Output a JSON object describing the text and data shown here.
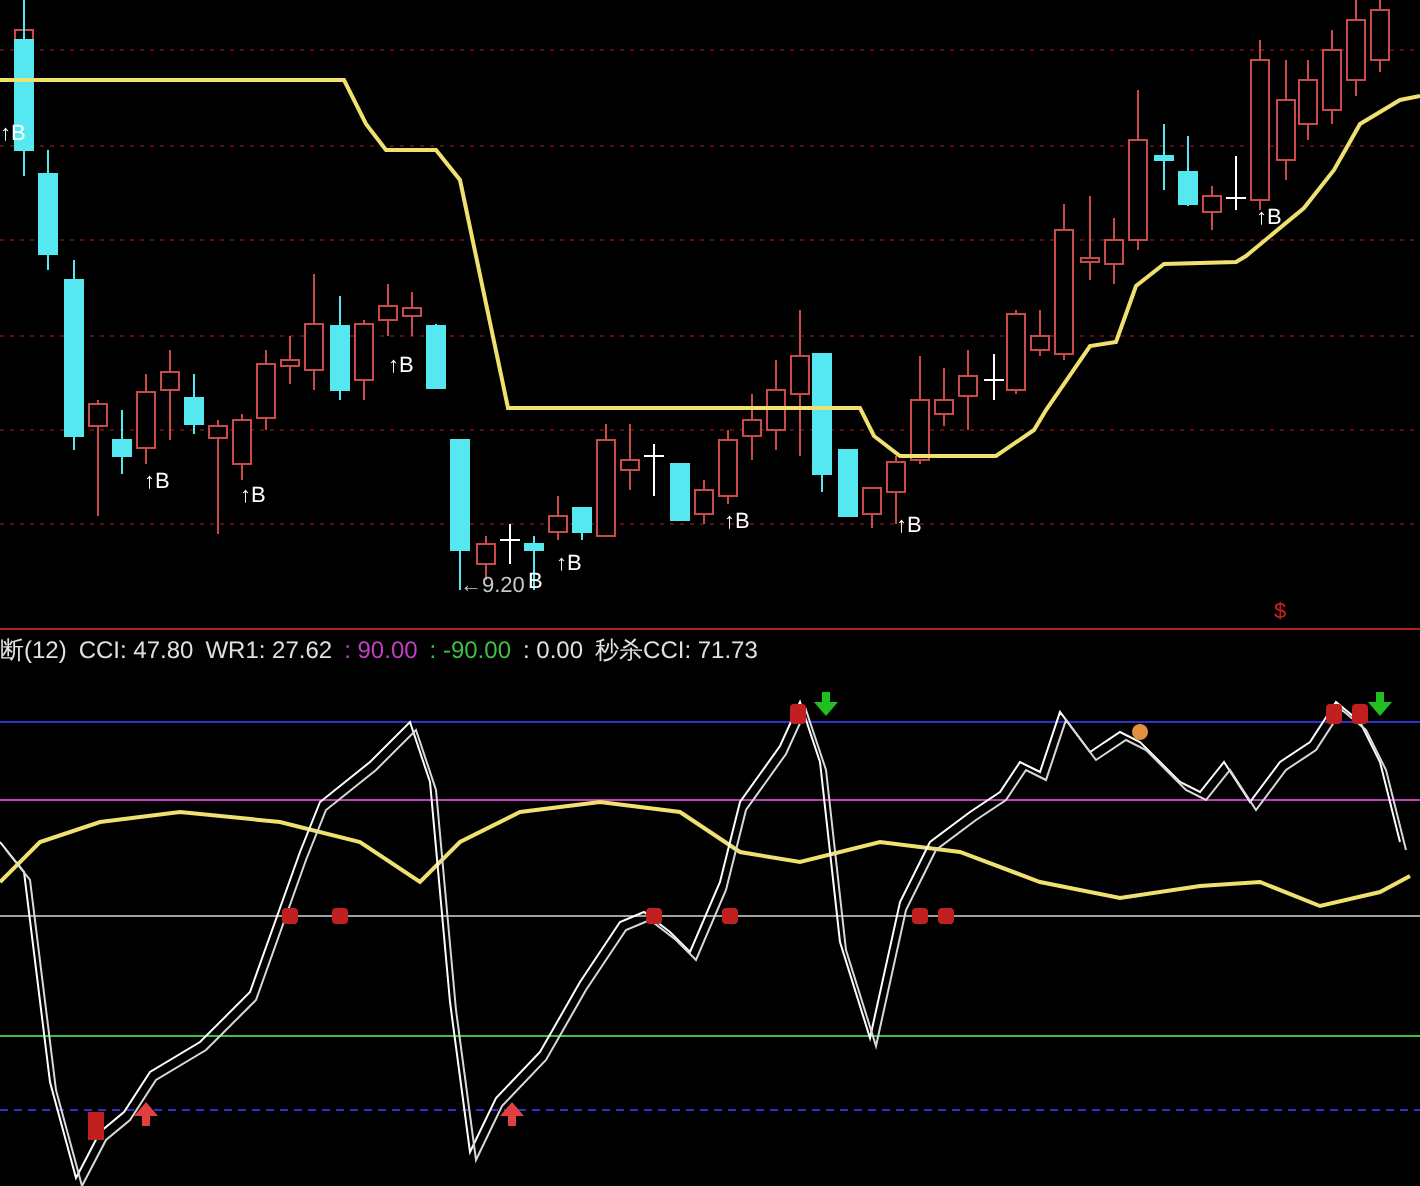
{
  "price_panel": {
    "signal_labels": [
      {
        "text": "↑B"
      },
      {
        "text": "↑B"
      },
      {
        "text": "↑B"
      },
      {
        "text": "↑B"
      },
      {
        "text": "B"
      },
      {
        "text": "↑B"
      },
      {
        "text": "↑B"
      },
      {
        "text": "↑B"
      },
      {
        "text": "↑B"
      }
    ],
    "low_label": "←9.20",
    "marker": "$"
  },
  "indicator_panel": {
    "title": "断(12)",
    "readings": [
      {
        "text": "CCI: 47.80",
        "color": "#e0e0e0"
      },
      {
        "text": "WR1: 27.62",
        "color": "#e0e0e0"
      },
      {
        "text": ": 90.00",
        "color": "#c040c0"
      },
      {
        "text": ": -90.00",
        "color": "#40c040"
      },
      {
        "text": ": 0.00",
        "color": "#e0e0e0"
      },
      {
        "text": "秒杀CCI: 71.73",
        "color": "#e0e0e0"
      }
    ]
  }
}
